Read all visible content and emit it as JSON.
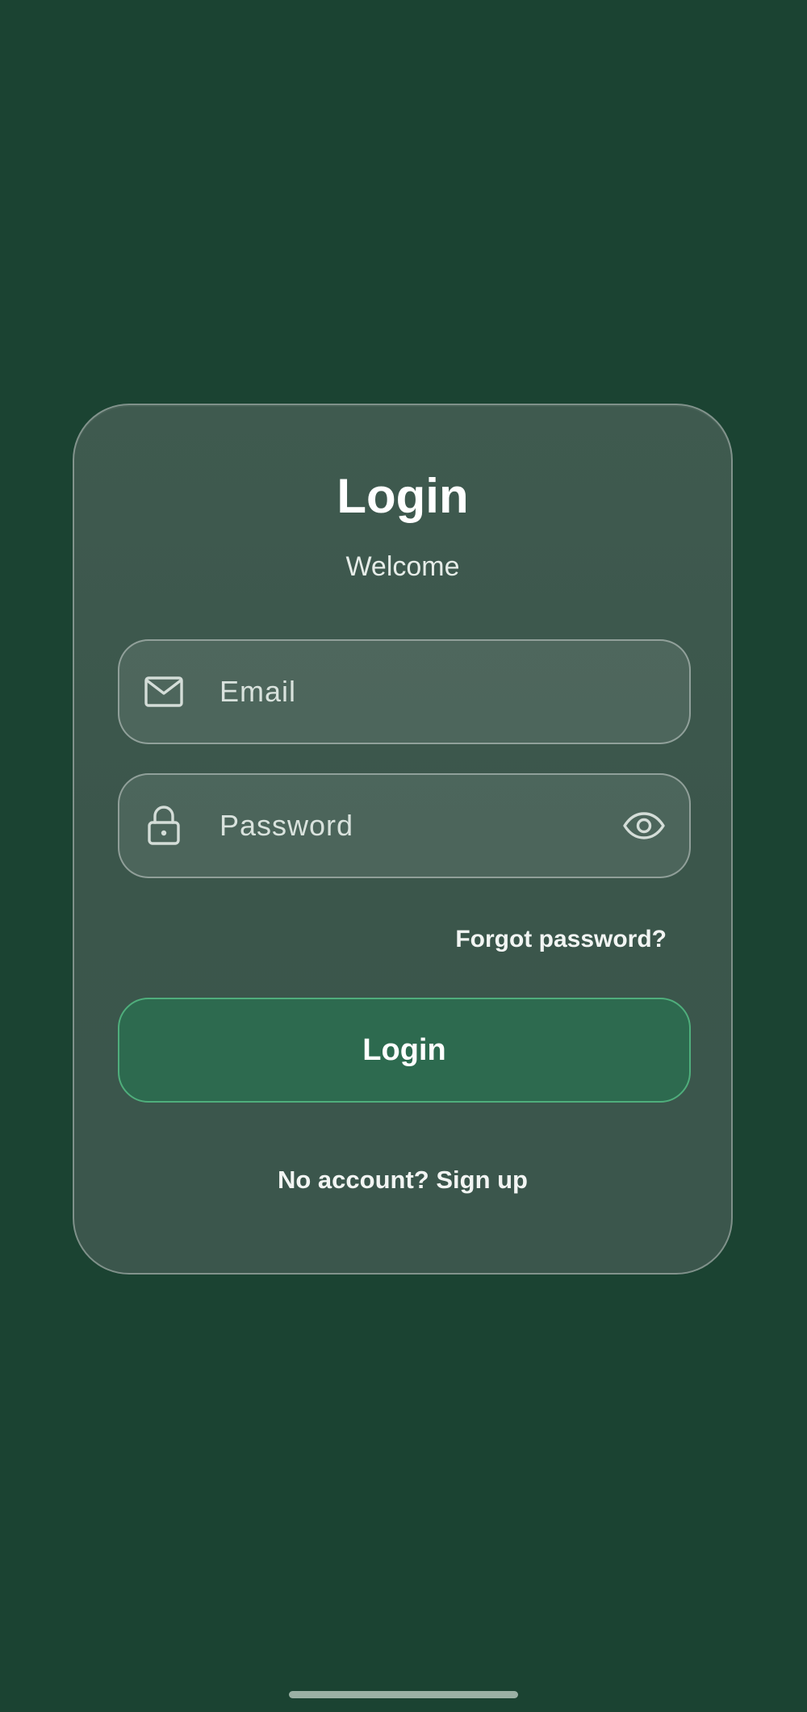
{
  "screen": {
    "background_color": "#1b4332",
    "accent_color": "#2d6a4f",
    "accent_border_color": "#4fae7c"
  },
  "login_card": {
    "title": "Login",
    "subtitle": "Welcome",
    "email": {
      "value": "",
      "placeholder": "Email",
      "icon": "mail-icon"
    },
    "password": {
      "value": "",
      "placeholder": "Password",
      "icon": "lock-icon",
      "toggle_icon": "eye-icon"
    },
    "forgot_password_label": "Forgot password?",
    "login_button_label": "Login",
    "signup_prompt": "No account? Sign up"
  },
  "system": {
    "home_indicator": "home-indicator"
  }
}
